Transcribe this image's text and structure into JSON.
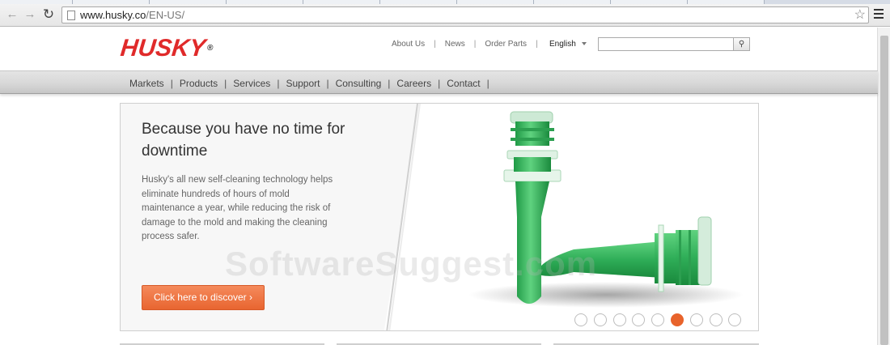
{
  "browser": {
    "back_icon": "back-arrow-icon",
    "forward_icon": "forward-arrow-icon",
    "reload_icon": "reload-icon",
    "url_host": "www.husky.co",
    "url_path": "/EN-US/",
    "bookmark_icon": "star-icon",
    "menu_icon": "hamburger-menu-icon"
  },
  "site": {
    "logo_text": "HUSKY",
    "logo_mark": "®",
    "brand_color": "#e02a2a",
    "utility_links": [
      "About Us",
      "News",
      "Order Parts"
    ],
    "language": "English",
    "search_placeholder": "",
    "search_icon": "magnifier-icon",
    "main_nav": [
      "Markets",
      "Products",
      "Services",
      "Support",
      "Consulting",
      "Careers",
      "Contact"
    ]
  },
  "hero": {
    "headline": "Because you have no time for downtime",
    "body": "Husky's all new self-cleaning technology helps eliminate hundreds of hours of mold maintenance a year, while reducing the risk of damage to the mold and making the cleaning process safer.",
    "cta_label": "Click here to discover ›",
    "cta_color": "#e8632b",
    "slides_total": 9,
    "active_slide": 6,
    "image_subject": "green-preform-image"
  },
  "watermark": "SoftwareSuggest.com"
}
